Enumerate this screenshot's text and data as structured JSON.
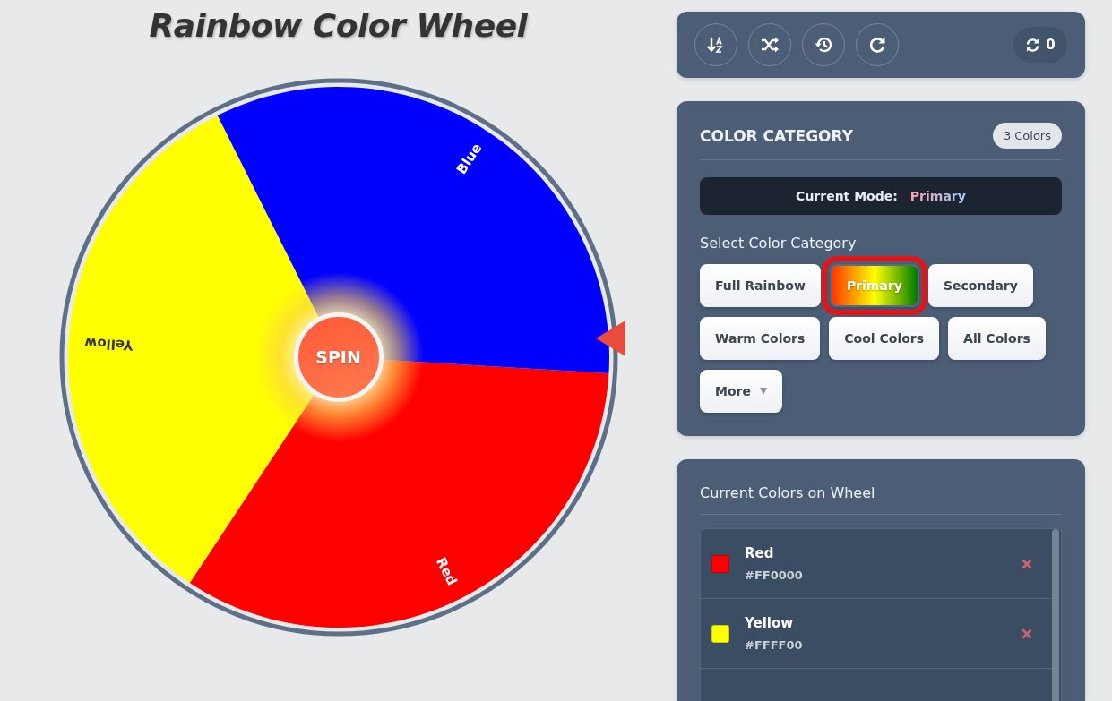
{
  "title": "Rainbow Color Wheel",
  "wheel": {
    "segments": [
      {
        "label": "Red",
        "color": "#ff0000"
      },
      {
        "label": "Yellow",
        "color": "#ffff00"
      },
      {
        "label": "Blue",
        "color": "#0000ff"
      }
    ],
    "spin_button": "SPIN"
  },
  "toolbar": {
    "buttons": [
      {
        "kind": "sort"
      },
      {
        "kind": "shuffle"
      },
      {
        "kind": "history"
      },
      {
        "kind": "redo"
      }
    ],
    "spin_count": "0"
  },
  "category_panel": {
    "heading": "COLOR CATEGORY",
    "badge": "3 Colors",
    "mode_label": "Current Mode:",
    "mode_value": "Primary",
    "select_label": "Select Color Category",
    "categories": [
      {
        "label": "Full Rainbow",
        "selected": false,
        "highlighted": false,
        "kind": "button"
      },
      {
        "label": "Primary",
        "selected": true,
        "highlighted": true,
        "kind": "button"
      },
      {
        "label": "Secondary",
        "selected": false,
        "highlighted": false,
        "kind": "button"
      },
      {
        "label": "Warm Colors",
        "selected": false,
        "highlighted": false,
        "kind": "button"
      },
      {
        "label": "Cool Colors",
        "selected": false,
        "highlighted": false,
        "kind": "button"
      },
      {
        "label": "All Colors",
        "selected": false,
        "highlighted": false,
        "kind": "button"
      },
      {
        "label": "More",
        "selected": false,
        "highlighted": false,
        "kind": "dropdown"
      }
    ]
  },
  "colors_panel": {
    "heading": "Current Colors on Wheel",
    "colors": [
      {
        "name": "Red",
        "hex": "#FF0000",
        "color": "#ff0000"
      },
      {
        "name": "Yellow",
        "hex": "#FFFF00",
        "color": "#ffff00"
      }
    ]
  }
}
